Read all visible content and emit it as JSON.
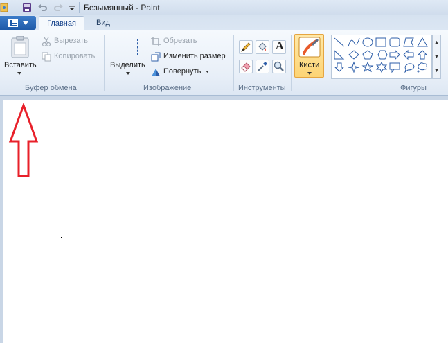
{
  "window": {
    "title": "Безымянный - Paint"
  },
  "tabs": [
    "Главная",
    "Вид"
  ],
  "clipboard": {
    "paste_label": "Вставить",
    "cut_label": "Вырезать",
    "copy_label": "Копировать",
    "group_label": "Буфер обмена"
  },
  "image": {
    "select_label": "Выделить",
    "crop_label": "Обрезать",
    "resize_label": "Изменить размер",
    "rotate_label": "Повернуть",
    "group_label": "Изображение"
  },
  "tools": {
    "group_label": "Инструменты",
    "items": [
      "pencil-icon",
      "fill-icon",
      "text-icon",
      "eraser-icon",
      "color-picker-icon",
      "magnifier-icon"
    ],
    "text_glyph": "A"
  },
  "brushes": {
    "label": "Кисти"
  },
  "shapes": {
    "group_label": "Фигуры",
    "items": [
      "line",
      "curve",
      "oval",
      "rectangle",
      "rounded-rectangle",
      "polygon",
      "triangle",
      "right-triangle",
      "diamond",
      "pentagon",
      "hexagon",
      "right-arrow",
      "left-arrow",
      "up-arrow",
      "down-arrow",
      "four-point-star",
      "five-point-star",
      "six-point-star",
      "rectangular-callout",
      "oval-callout",
      "cloud-callout"
    ]
  },
  "annotation": {
    "color": "#e8202a",
    "shape": "up-arrow"
  },
  "colors": {
    "accent": "#1f5aa8",
    "brush_highlight": "#fdd475",
    "annotation": "#e8202a"
  }
}
